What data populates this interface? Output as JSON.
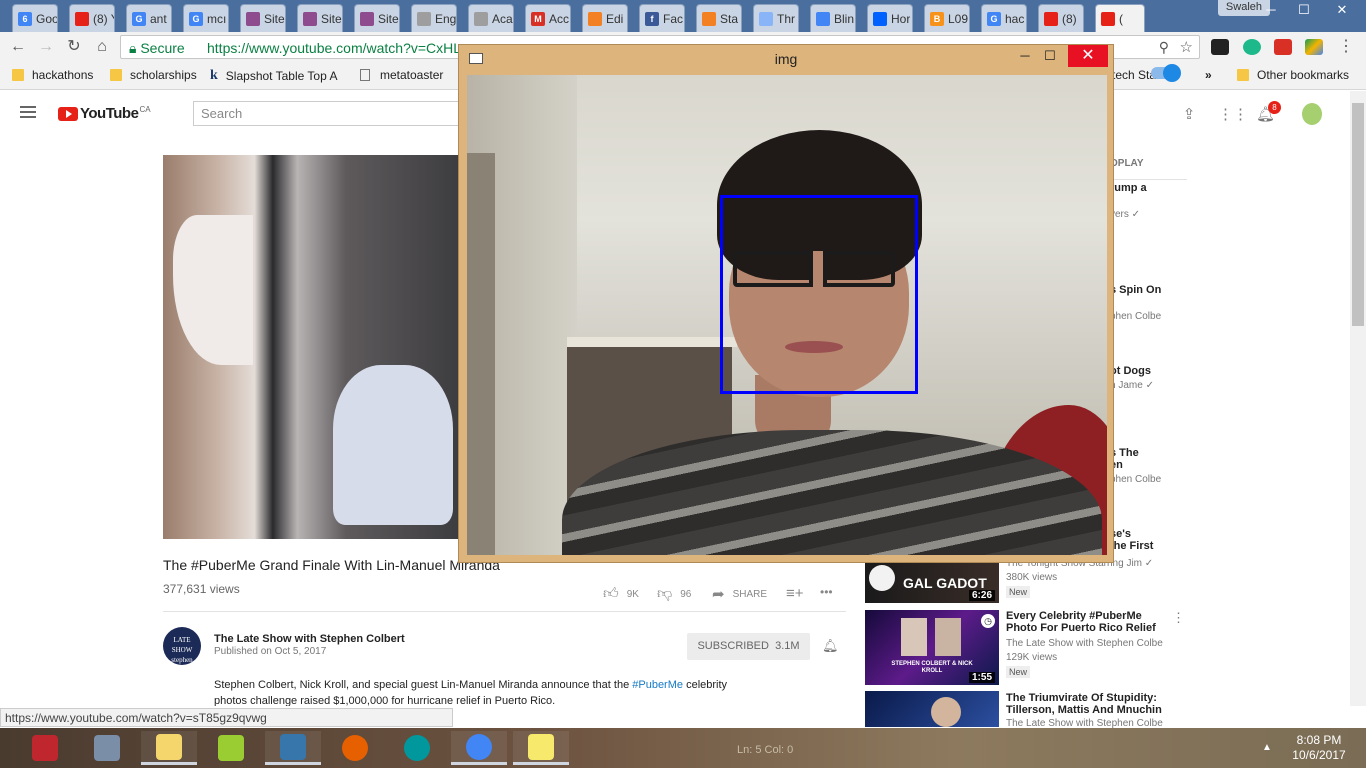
{
  "browser": {
    "tabs": [
      {
        "label": "Goo",
        "color": "#4285f4",
        "glyph": "6"
      },
      {
        "label": "(8) Y",
        "color": "#e62117",
        "glyph": ""
      },
      {
        "label": "ant",
        "color": "#4285f4",
        "glyph": "G"
      },
      {
        "label": "mcı",
        "color": "#4285f4",
        "glyph": "G"
      },
      {
        "label": "Site",
        "color": "#8e4b8e",
        "glyph": ""
      },
      {
        "label": "Site",
        "color": "#8e4b8e",
        "glyph": ""
      },
      {
        "label": "Site",
        "color": "#8e4b8e",
        "glyph": ""
      },
      {
        "label": "Eng",
        "color": "#9e9e9e",
        "glyph": ""
      },
      {
        "label": "Aca",
        "color": "#9e9e9e",
        "glyph": ""
      },
      {
        "label": "Acc",
        "color": "#d93025",
        "glyph": "M"
      },
      {
        "label": "Edi",
        "color": "#f48024",
        "glyph": ""
      },
      {
        "label": "Fac",
        "color": "#3b5998",
        "glyph": "f"
      },
      {
        "label": "Sta",
        "color": "#f48024",
        "glyph": ""
      },
      {
        "label": "Thr",
        "color": "#8ab4f8",
        "glyph": ""
      },
      {
        "label": "Blin",
        "color": "#4285f4",
        "glyph": ""
      },
      {
        "label": "Hor",
        "color": "#0061ff",
        "glyph": ""
      },
      {
        "label": "L09",
        "color": "#f7931a",
        "glyph": "B"
      },
      {
        "label": "hac",
        "color": "#4285f4",
        "glyph": "G"
      },
      {
        "label": "(8)",
        "color": "#e62117",
        "glyph": ""
      },
      {
        "label": "(",
        "color": "#e62117",
        "glyph": ""
      }
    ],
    "profile_name": "Swaleh",
    "secure_label": "Secure",
    "url": "https://www.youtube.com/watch?v=CxHL",
    "bookmarks": {
      "items": [
        "hackathons",
        "scholarships",
        "Slapshot Table Top A",
        "metatoaster"
      ],
      "overflow_partial": "tech Startup",
      "overflow_chevron": "»",
      "other": "Other bookmarks"
    },
    "status_url": "https://www.youtube.com/watch?v=sT85gz9qvwg"
  },
  "youtube": {
    "logo_text": "YouTube",
    "country": "CA",
    "search_placeholder": "Search",
    "notification_count": "8",
    "video": {
      "title": "The #PuberMe Grand Finale With Lin-Manuel Miranda",
      "views": "377,631 views",
      "likes": "9K",
      "dislikes": "96",
      "share_label": "SHARE",
      "more_label": "•••"
    },
    "channel": {
      "name": "The Late Show with Stephen Colbert",
      "avatar_text": "LATE SHOW stephen colbert",
      "published": "Published on Oct 5, 2017",
      "subscribe_label": "SUBSCRIBED",
      "subscriber_count": "3.1M"
    },
    "description": {
      "before": "Stephen Colbert, Nick Kroll, and special guest Lin-Manuel Miranda announce that the ",
      "hashtag": "#PuberMe",
      "after": " celebrity photos challenge raised $1,000,000 for hurricane relief in Puerto Rico."
    },
    "sidebar": {
      "autoplay_partial": "OPLAY",
      "partial_texts": [
        {
          "text": "rump a",
          "kind": "title"
        },
        {
          "text": "yers ✓",
          "kind": "meta"
        },
        {
          "text": "s Spin On",
          "kind": "title"
        },
        {
          "text": "phen Colbe",
          "kind": "meta"
        },
        {
          "text": "ot Dogs",
          "kind": "title"
        },
        {
          "text": "n Jame ✓",
          "kind": "meta"
        },
        {
          "text": "s The",
          "kind": "title"
        },
        {
          "text": "en",
          "kind": "title"
        },
        {
          "text": "phen Colbe",
          "kind": "meta"
        },
        {
          "text": "se's",
          "kind": "title"
        },
        {
          "text": "the First",
          "kind": "title"
        }
      ],
      "items": [
        {
          "thumb_text": "GAL GADOT",
          "duration": "6:26",
          "channel": "The Tonight Show Starring Jim ✓",
          "views": "380K views",
          "badge": "New"
        },
        {
          "title": "Every Celebrity #PuberMe Photo For Puerto Rico Relief",
          "thumb_text": "STEPHEN COLBERT & NICK KROLL",
          "duration": "1:55",
          "channel": "The Late Show with Stephen Colbe",
          "views": "129K views",
          "badge": "New"
        },
        {
          "title": "The Triumvirate Of Stupidity: Tillerson, Mattis And Mnuchin",
          "channel": "The Late Show with Stephen Colbe"
        }
      ]
    }
  },
  "img_window": {
    "title": "img",
    "minimize": "─",
    "maximize": "☐",
    "close": "✕",
    "detection_box_color": "#0000ff"
  },
  "taskbar": {
    "notepad_status": "Ln: 5   Col: 0",
    "time": "8:08 PM",
    "date": "10/6/2017",
    "apps": [
      {
        "name": "flash",
        "color": "#c0262d",
        "open": false
      },
      {
        "name": "window-switcher",
        "color": "#7a8ea8",
        "open": false
      },
      {
        "name": "file-explorer",
        "color": "#f5d66d",
        "open": true
      },
      {
        "name": "pencil",
        "color": "#9acd32",
        "open": false
      },
      {
        "name": "python",
        "color": "#3776ab",
        "open": true
      },
      {
        "name": "firefox",
        "color": "#e66000",
        "open": false
      },
      {
        "name": "arduino",
        "color": "#00979d",
        "open": false
      },
      {
        "name": "chrome",
        "color": "#4285f4",
        "open": true
      },
      {
        "name": "sticky-notes",
        "color": "#f7e96b",
        "open": true
      }
    ]
  }
}
